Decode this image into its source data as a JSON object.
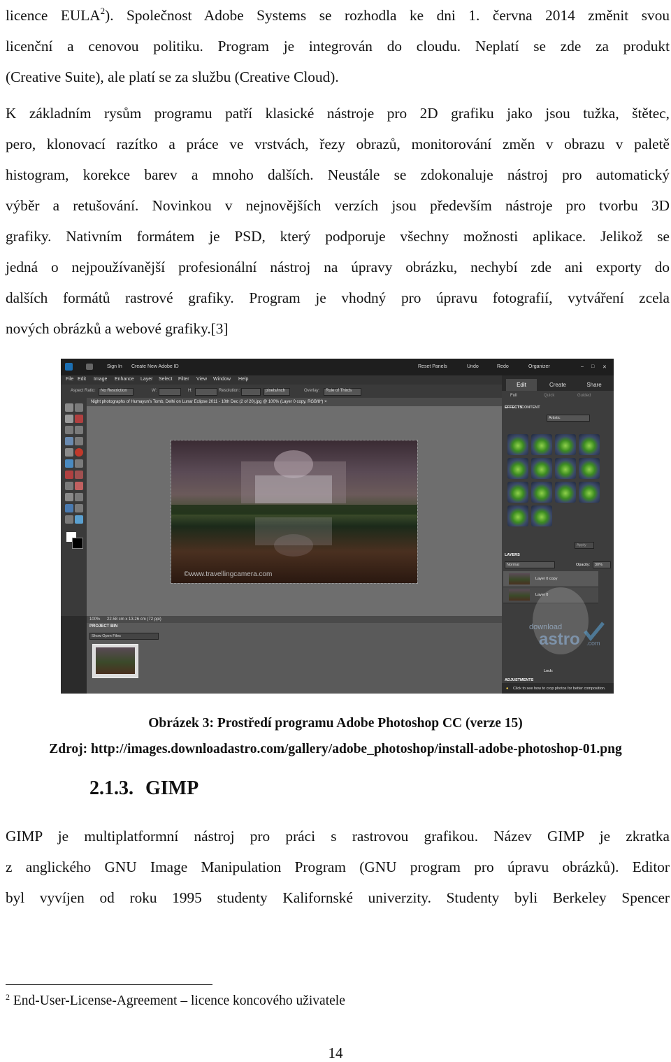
{
  "paragraphs": {
    "p1": [
      "licence EULA",
      "2",
      "). Společnost Adobe Systems se rozhodla ke dni 1. června 2014 změnit svou",
      "licenční a cenovou politiku. Program je integrován do cloudu. Neplatí se zde za produkt",
      "(Creative Suite), ale platí se za službu (Creative Cloud)."
    ],
    "p2": [
      "K základním rysům programu patří klasické nástroje pro 2D grafiku jako jsou tužka, štětec,",
      "pero, klonovací razítko a práce ve vrstvách, řezy obrazů, monitorování změn v obrazu v paletě",
      "histogram, korekce barev a mnoho dalších. Neustále se zdokonaluje nástroj pro automatický",
      "výběr a retušování. Novinkou v nejnovějších verzích jsou především nástroje pro tvorbu 3D",
      "grafiky. Nativním formátem je PSD, který podporuje všechny možnosti aplikace. Jelikož se",
      "jedná o nejpoužívanější profesionální nástroj na úpravy obrázku, nechybí zde ani exporty do",
      "dalších formátů rastrové grafiky. Program je vhodný pro úpravu fotografií, vytváření zcela",
      "nových obrázků a webové grafiky.[3]"
    ],
    "p3": [
      "GIMP je multiplatformní nástroj pro práci s rastrovou grafikou. Název GIMP je zkratka",
      "z anglického GNU Image Manipulation Program (GNU program pro úpravu obrázků). Editor",
      "byl vyvíjen od roku 1995 studenty Kalifornské univerzity. Studenty byli Berkeley Spencer"
    ]
  },
  "figure": {
    "titlebar": {
      "sign_in": "Sign In",
      "create_id": "Create New Adobe ID",
      "reset_panels": "Reset Panels",
      "undo": "Undo",
      "redo": "Redo",
      "organizer": "Organizer"
    },
    "menu": [
      "File",
      "Edit",
      "Image",
      "Enhance",
      "Layer",
      "Select",
      "Filter",
      "View",
      "Window",
      "Help"
    ],
    "options": {
      "aspect_label": "Aspect Ratio:",
      "aspect_value": "No Restriction",
      "w_label": "W:",
      "h_label": "H:",
      "res_label": "Resolution:",
      "res_unit": "pixels/inch",
      "overlay_label": "Overlay:",
      "overlay_value": "Rule of Thirds"
    },
    "doc_tab": "Night photographs of Humayun's Tomb, Delhi on Lunar Eclipse 2011 - 10th Dec (2 of 20).jpg @ 100% (Layer 0 copy, RGB/8*) ×",
    "photo_watermark": "©www.travellingcamera.com",
    "status": {
      "zoom": "100%",
      "size": "22.58 cm x 13.26 cm (72 ppi)"
    },
    "project_bin": {
      "header": "PROJECT BIN",
      "dropdown": "Show Open Files"
    },
    "right_panel": {
      "tabs": [
        "Edit",
        "Create",
        "Share"
      ],
      "modes": [
        "Full",
        "Quick",
        "Guided"
      ],
      "effects_tabs": [
        "EFFECTS",
        "CONTENT"
      ],
      "effects_filter": "Artistic",
      "apply": "Apply",
      "layers_label": "LAYERS",
      "blend_mode": "Normal",
      "opacity_label": "Opacity:",
      "opacity_value": "30%",
      "layers": [
        "Layer 0 copy",
        "Layer 0"
      ],
      "lock_label": "Lock:",
      "adjustments_label": "ADJUSTMENTS",
      "tip": "Click to see how to crop photos for better composition."
    },
    "site_watermark": [
      "download",
      "astro",
      ".com"
    ]
  },
  "captions": {
    "figure": "Obrázek 3: Prostředí programu Adobe Photoshop CC (verze 15)",
    "source": "Zdroj: http://images.downloadastro.com/gallery/adobe_photoshop/install-adobe-photoshop-01.png"
  },
  "heading": {
    "number": "2.1.3.",
    "title": "GIMP"
  },
  "footnote": {
    "marker": "2",
    "text": " End-User-License-Agreement – licence koncového uživatele"
  },
  "page_number": "14",
  "colors": {
    "app_dark": "#2b2b2b",
    "canvas_gray": "#6e6e6e",
    "effect_green": "#3c8b22"
  }
}
